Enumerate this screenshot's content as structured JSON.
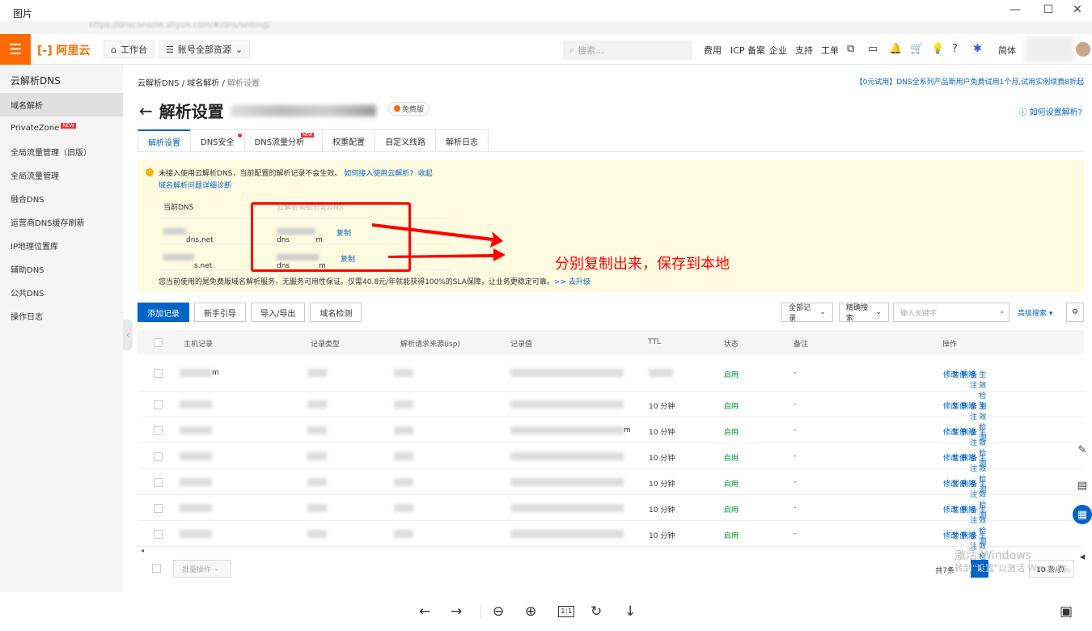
{
  "window": {
    "title": "图片",
    "min": "—",
    "max": "☐",
    "close": "✕"
  },
  "browser": {
    "url": "https://dnsconsole.aliyun.com/#/dns/setting/"
  },
  "topbar": {
    "logo": "阿里云",
    "workbench": "工作台",
    "resources": "账号全部资源",
    "search_placeholder": "搜索...",
    "nav": [
      "费用",
      "ICP 备案",
      "企业",
      "支持",
      "工单"
    ],
    "lang": "简体"
  },
  "sidebar": {
    "title": "云解析DNS",
    "items": [
      {
        "label": "域名解析"
      },
      {
        "label": "PrivateZone",
        "badge": "NEW"
      },
      {
        "label": "全局流量管理（旧版）"
      },
      {
        "label": "全局流量管理"
      },
      {
        "label": "融合DNS"
      },
      {
        "label": "运营商DNS缓存刷新"
      },
      {
        "label": "IP地理位置库"
      },
      {
        "label": "辅助DNS"
      },
      {
        "label": "公共DNS"
      },
      {
        "label": "操作日志"
      }
    ]
  },
  "breadcrumb": {
    "a": "云解析DNS",
    "b": "域名解析",
    "c": "解析设置"
  },
  "promo": "【0元试用】DNS全系列产品新用户免费试用1个月,试用实例续费8折起",
  "page": {
    "title": "解析设置",
    "domain_suffix": ".com",
    "edition": "免费版",
    "help": "如何设置解析?"
  },
  "tabs": [
    {
      "label": "解析设置"
    },
    {
      "label": "DNS安全"
    },
    {
      "label": "DNS流量分析",
      "badge": "NEW"
    },
    {
      "label": "权重配置"
    },
    {
      "label": "自定义线路"
    },
    {
      "label": "解析日志"
    }
  ],
  "notice": {
    "line1": "未接入使用云解析DNS，当前配置的解析记录不会生效。",
    "link1": "如何接入使用云解析?",
    "link2": "收起",
    "line2": "域名解析问题详细诊断",
    "col1": "当前DNS",
    "col2": "云解析系统分配DNS",
    "rows": [
      {
        "cur": "dns.net",
        "alloc_a": "dns",
        "alloc_b": "m",
        "copy": "复制"
      },
      {
        "cur": "s.net",
        "alloc_a": "dns",
        "alloc_b": "m",
        "copy": "复制"
      }
    ],
    "line3": "您当前使用的是免费版域名解析服务，无服务可用性保证。仅需40.8元/年就能获得100%的SLA保障，让业务更稳定可靠。",
    "upgrade": ">> 去升级"
  },
  "annotation": "分别复制出来，保存到本地",
  "toolbar": {
    "add": "添加记录",
    "guide": "新手引导",
    "io": "导入/导出",
    "check": "域名检测",
    "all": "全部记录",
    "exact": "精确搜索",
    "kw": "输入关键字",
    "adv": "高级搜索"
  },
  "table": {
    "headers": {
      "host": "主机记录",
      "type": "记录类型",
      "isp": "解析请求来源(isp)",
      "value": "记录值",
      "ttl": "TTL",
      "status": "状态",
      "remark": "备注",
      "ops": "操作"
    },
    "rows": [
      {
        "host": "m",
        "value": "",
        "ttl": "",
        "status": "启用",
        "remark": "-"
      },
      {
        "host": "",
        "value": "",
        "ttl": "10 分钟",
        "status": "启用",
        "remark": "-"
      },
      {
        "host": "",
        "value": "m",
        "ttl": "10 分钟",
        "status": "启用",
        "remark": "-"
      },
      {
        "host": "",
        "value": "",
        "ttl": "10 分钟",
        "status": "启用",
        "remark": "-"
      },
      {
        "host": "",
        "value": "",
        "ttl": "10 分钟",
        "status": "启用",
        "remark": "-"
      },
      {
        "host": "",
        "value": "",
        "ttl": "10 分钟",
        "status": "启用",
        "remark": "-"
      },
      {
        "host": "",
        "value": "",
        "ttl": "10 分钟",
        "status": "启用",
        "remark": "-"
      }
    ],
    "ops": {
      "edit": "修改",
      "pause": "暂停",
      "del": "删除",
      "note": "备注",
      "check": "生效检测"
    }
  },
  "footer": {
    "batch": "批量操作",
    "total": "共7条",
    "page": "1",
    "size": "10 条/页"
  },
  "watermark": {
    "a": "激活 Windows",
    "b": "转到\"设置\"以激活 Windows。"
  }
}
